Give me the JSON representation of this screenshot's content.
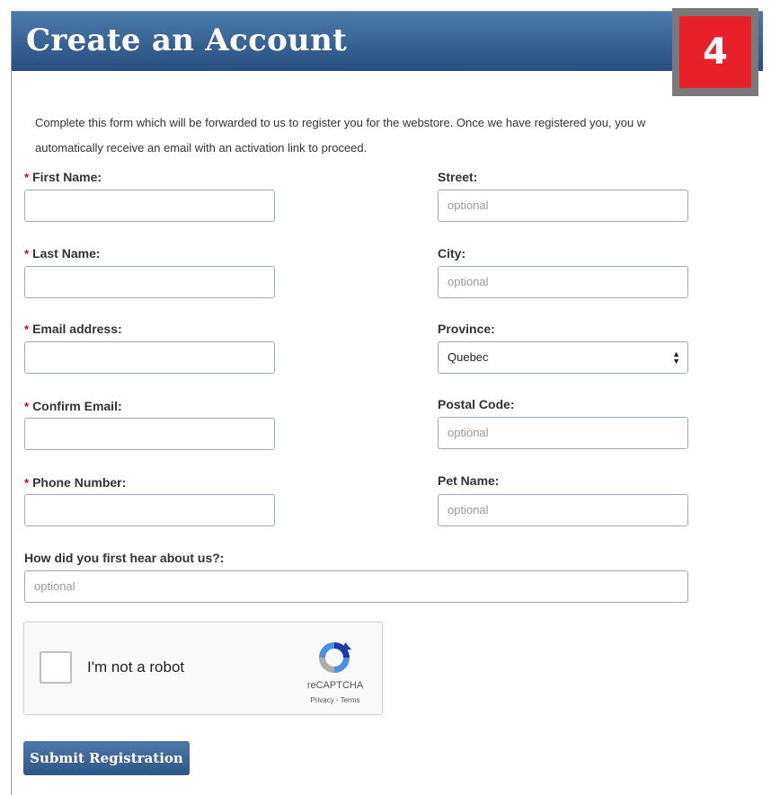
{
  "header": {
    "title": "Create an Account"
  },
  "step_badge": "4",
  "intro": {
    "line1": "Complete this form which will be forwarded to us to register you for the webstore. Once we have registered you, you w",
    "line2": "automatically receive an email with an activation link to proceed."
  },
  "required_marker": "*",
  "left_fields": [
    {
      "label": "First Name:",
      "value": ""
    },
    {
      "label": "Last Name:",
      "value": ""
    },
    {
      "label": "Email address:",
      "value": ""
    },
    {
      "label": "Confirm Email:",
      "value": ""
    },
    {
      "label": "Phone Number:",
      "value": ""
    }
  ],
  "right_fields": {
    "street": {
      "label": "Street:",
      "placeholder": "optional"
    },
    "city": {
      "label": "City:",
      "placeholder": "optional"
    },
    "province": {
      "label": "Province:",
      "selected": "Quebec"
    },
    "postal_code": {
      "label": "Postal Code:",
      "placeholder": "optional"
    },
    "pet_name": {
      "label": "Pet Name:",
      "placeholder": "optional"
    }
  },
  "hear_about": {
    "label": "How did you first hear about us?:",
    "placeholder": "optional"
  },
  "captcha": {
    "checkbox_label": "I'm not a robot",
    "brand": "reCAPTCHA",
    "links": "Privacy - Terms",
    "logo_icon": "recaptcha-logo-icon"
  },
  "submit_label": "Submit Registration",
  "colors": {
    "header_top": "#4a7bab",
    "header_bottom": "#264f80",
    "required": "#d0021b",
    "badge": "#e8202a",
    "button": "#2d5687"
  }
}
